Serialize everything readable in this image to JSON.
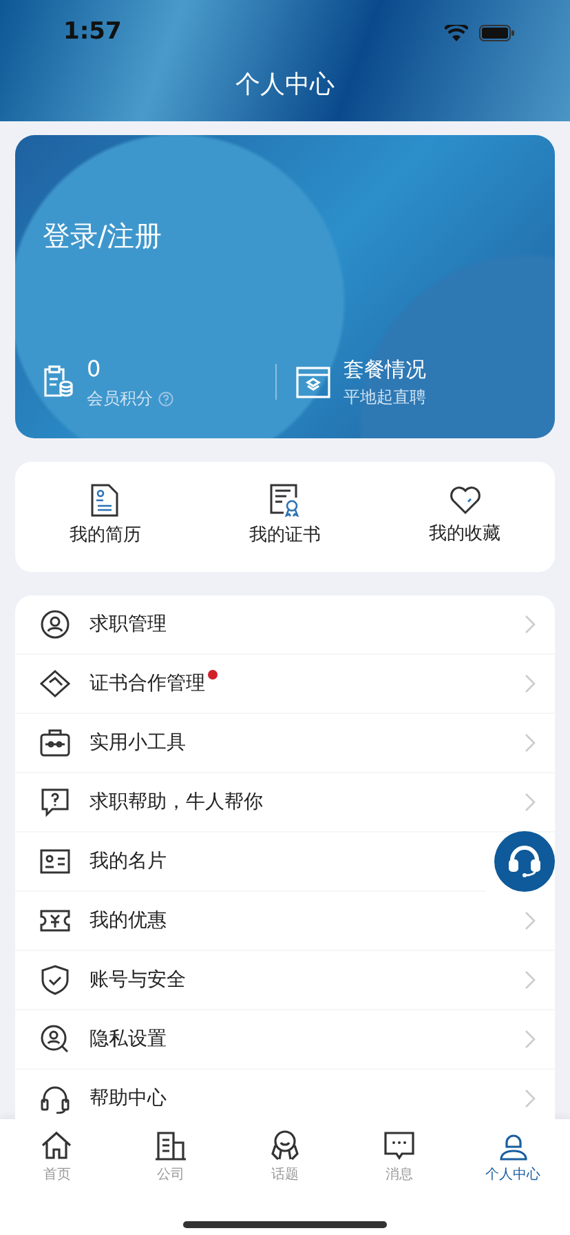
{
  "status_bar": {
    "time": "1:57"
  },
  "header": {
    "title": "个人中心"
  },
  "profile_card": {
    "login": "登录/注册",
    "points_value": "0",
    "points_label": "会员积分",
    "package_title": "套餐情况",
    "package_subtitle": "平地起直聘"
  },
  "shortcuts": [
    {
      "kind": "resume",
      "label": "我的简历"
    },
    {
      "kind": "certificate",
      "label": "我的证书"
    },
    {
      "kind": "favorite",
      "label": "我的收藏"
    }
  ],
  "menu": [
    {
      "kind": "job",
      "label": "求职管理",
      "badge": false,
      "arrow": true
    },
    {
      "kind": "handshake",
      "label": "证书合作管理",
      "badge": true,
      "arrow": true
    },
    {
      "kind": "toolbox",
      "label": "实用小工具",
      "badge": false,
      "arrow": true
    },
    {
      "kind": "help",
      "label": "求职帮助，牛人帮你",
      "badge": false,
      "arrow": true
    },
    {
      "kind": "card",
      "label": "我的名片",
      "badge": false,
      "arrow": false
    },
    {
      "kind": "coupon",
      "label": "我的优惠",
      "badge": false,
      "arrow": true
    },
    {
      "kind": "shield",
      "label": "账号与安全",
      "badge": false,
      "arrow": true
    },
    {
      "kind": "privacy",
      "label": "隐私设置",
      "badge": false,
      "arrow": true
    },
    {
      "kind": "headset",
      "label": "帮助中心",
      "badge": false,
      "arrow": true
    }
  ],
  "tabs": [
    {
      "kind": "home",
      "label": "首页",
      "selected": false
    },
    {
      "kind": "company",
      "label": "公司",
      "selected": false
    },
    {
      "kind": "topic",
      "label": "话题",
      "selected": false
    },
    {
      "kind": "message",
      "label": "消息",
      "selected": false
    },
    {
      "kind": "profile",
      "label": "个人中心",
      "selected": true
    }
  ]
}
